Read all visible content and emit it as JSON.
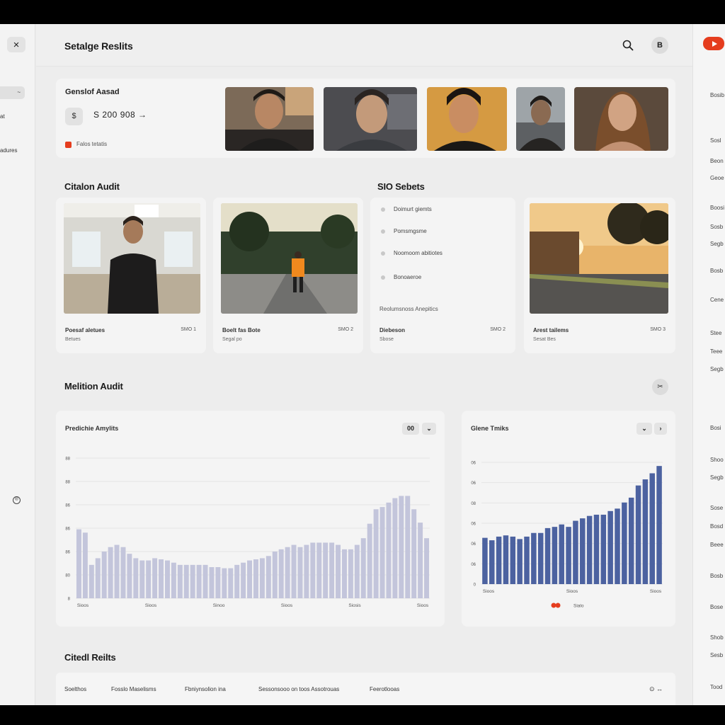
{
  "sidebar": {
    "close_icon": "×",
    "pill_label": "~",
    "items": [
      "at",
      "adures"
    ],
    "bottom_icon": "®"
  },
  "topbar": {
    "title": "Setalge Reslits",
    "avatar_label": "B"
  },
  "stats": {
    "label": "Genslof Aasad",
    "currency_icon": "$",
    "value": "S 200 908 →",
    "note": "Falos tetatis"
  },
  "sections": {
    "citation_audit": "Citalon Audit",
    "sio_sets": "SIO Sebets",
    "motion_audit": "Melition Audit",
    "cited_results": "Citedl Reilts"
  },
  "media_cards": [
    {
      "label": "Poesaf aletues",
      "sub": "Betues",
      "meta": "SMO  1"
    },
    {
      "label": "Boelt fas Bote",
      "sub": "Segal po",
      "meta": "SMO  2"
    },
    {
      "label": "Diebeson",
      "sub": "Sbose",
      "meta": "SMO  2"
    },
    {
      "label": "Arest tailems",
      "sub": "Sesat Bes",
      "meta": "SMO  3"
    }
  ],
  "sio_list": {
    "items": [
      "Doimurt giemts",
      "Pomsmgsme",
      "Noomoom abitiotes",
      "Bonoaeroe"
    ],
    "footer": "Reolumsnoss Anepitics"
  },
  "motion_button_icon": "✂",
  "chart_left": {
    "title": "Predichie Amylits",
    "control_label": "00",
    "control_icon": "⌄"
  },
  "chart_right": {
    "title": "Glene Tmiks",
    "control_icons": [
      "⌄",
      "›"
    ]
  },
  "results": {
    "columns": [
      "Soelthos",
      "Fosslo Maselisms",
      "Fbniynsolion ina",
      "Sessonsooo on toos Assotrouas",
      "Feerotlooas"
    ],
    "icons": "⊙  ↔"
  },
  "right_strip": {
    "items": [
      "Bosib",
      "Sosl",
      "Beon",
      "Geoe",
      "Boosi",
      "Sosb",
      "Segb",
      "Bosb",
      "Cene",
      "Stee",
      "Teee",
      "Segb",
      "Bosi",
      "Shoo",
      "Segb",
      "Sose",
      "Bosd",
      "Beee",
      "Bosb",
      "Bose",
      "Shob",
      "Sesb",
      "Tood"
    ]
  },
  "colors": {
    "accent_red": "#e53d1e",
    "bar_light": "#c3c5db",
    "bar_dark": "#4c62a0"
  },
  "chart_data": [
    {
      "type": "bar",
      "title": "Predichie Amylits",
      "y_tick_labels": [
        "88",
        "88",
        "86",
        "86",
        "86",
        "80",
        "8"
      ],
      "x_tick_labels": [
        "Sioos",
        "Sioos",
        "Sinoo",
        "Sioos",
        "Siosis",
        "Sioos"
      ],
      "values": [
        62,
        59,
        30,
        36,
        42,
        46,
        48,
        46,
        40,
        36,
        34,
        34,
        36,
        35,
        34,
        32,
        30,
        30,
        30,
        30,
        30,
        28,
        28,
        27,
        27,
        30,
        32,
        34,
        35,
        36,
        38,
        42,
        44,
        46,
        48,
        46,
        48,
        50,
        50,
        50,
        50,
        48,
        44,
        44,
        48,
        54,
        67,
        80,
        82,
        86,
        90,
        92,
        92,
        80,
        68,
        54
      ],
      "ylim": [
        0,
        126
      ],
      "color": "#c3c5db"
    },
    {
      "type": "bar",
      "title": "Glene Tmiks",
      "y_tick_labels": [
        "06",
        "06",
        "08",
        "06",
        "06",
        "06",
        "0"
      ],
      "x_tick_labels": [
        "Sioos",
        "Sioos",
        "Sioos"
      ],
      "legend": "Sialo",
      "values": [
        38,
        36,
        39,
        40,
        39,
        37,
        39,
        42,
        42,
        46,
        47,
        49,
        47,
        52,
        54,
        56,
        57,
        57,
        60,
        62,
        67,
        71,
        81,
        86,
        91,
        97
      ],
      "ylim": [
        0,
        100
      ],
      "color": "#4c62a0"
    }
  ]
}
